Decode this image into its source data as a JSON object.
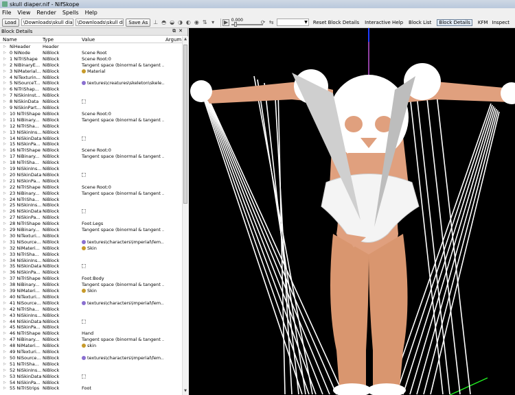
{
  "window": {
    "title": "skull diaper.nif - NifSkope"
  },
  "menu": [
    "File",
    "View",
    "Render",
    "Spells",
    "Help"
  ],
  "toolbar": {
    "load_label": "Load",
    "load_path": "\\Downloads\\skull diaper.nif",
    "save_path": "\\Downloads\\skull diaper.nif",
    "save_as_label": "Save As",
    "slider_value": "0.000",
    "links": [
      "Reset Block Details",
      "Interactive Help",
      "Block List",
      "Block Details",
      "KFM",
      "Inspect"
    ],
    "active_link": "Block Details"
  },
  "panel": {
    "title": "Block Details",
    "columns": [
      "Name",
      "Type",
      "Value",
      "Argum"
    ],
    "rows": [
      {
        "name": "NiHeader",
        "type": "Header",
        "value": "",
        "icon": ""
      },
      {
        "name": "0 NiNode",
        "type": "NiBlock",
        "value": "Scene Root",
        "icon": ""
      },
      {
        "name": "1 NiTriShape",
        "type": "NiBlock",
        "value": "Scene Root:0",
        "icon": ""
      },
      {
        "name": "2 NiBinaryE...",
        "type": "NiBlock",
        "value": "Tangent space (binormal & tangent ...",
        "icon": ""
      },
      {
        "name": "3 NiMaterial...",
        "type": "NiBlock",
        "value": "Material",
        "icon": "material"
      },
      {
        "name": "4 NiTexturin...",
        "type": "NiBlock",
        "value": "",
        "icon": ""
      },
      {
        "name": "5 NiSourceT...",
        "type": "NiBlock",
        "value": "textures\\creatures\\skeleton\\skele...",
        "icon": "texture"
      },
      {
        "name": "6 NiTriShap...",
        "type": "NiBlock",
        "value": "",
        "icon": ""
      },
      {
        "name": "7 NiSkinInst...",
        "type": "NiBlock",
        "value": "",
        "icon": ""
      },
      {
        "name": "8 NiSkinData",
        "type": "NiBlock",
        "value": "",
        "icon": "skin"
      },
      {
        "name": "9 NiSkinPart...",
        "type": "NiBlock",
        "value": "",
        "icon": ""
      },
      {
        "name": "10 NiTriShape",
        "type": "NiBlock",
        "value": "Scene Root:0",
        "icon": ""
      },
      {
        "name": "11 NiBinary...",
        "type": "NiBlock",
        "value": "Tangent space (binormal & tangent ...",
        "icon": ""
      },
      {
        "name": "12 NiTriSha...",
        "type": "NiBlock",
        "value": "",
        "icon": ""
      },
      {
        "name": "13 NiSkinIns...",
        "type": "NiBlock",
        "value": "",
        "icon": ""
      },
      {
        "name": "14 NiSkinData",
        "type": "NiBlock",
        "value": "",
        "icon": "skin"
      },
      {
        "name": "15 NiSkinPa...",
        "type": "NiBlock",
        "value": "",
        "icon": ""
      },
      {
        "name": "16 NiTriShape",
        "type": "NiBlock",
        "value": "Scene Root:0",
        "icon": ""
      },
      {
        "name": "17 NiBinary...",
        "type": "NiBlock",
        "value": "Tangent space (binormal & tangent ...",
        "icon": ""
      },
      {
        "name": "18 NiTriSha...",
        "type": "NiBlock",
        "value": "",
        "icon": ""
      },
      {
        "name": "19 NiSkinIns...",
        "type": "NiBlock",
        "value": "",
        "icon": ""
      },
      {
        "name": "20 NiSkinData",
        "type": "NiBlock",
        "value": "",
        "icon": "skin"
      },
      {
        "name": "21 NiSkinPa...",
        "type": "NiBlock",
        "value": "",
        "icon": ""
      },
      {
        "name": "22 NiTriShape",
        "type": "NiBlock",
        "value": "Scene Root:0",
        "icon": ""
      },
      {
        "name": "23 NiBinary...",
        "type": "NiBlock",
        "value": "Tangent space (binormal & tangent ...",
        "icon": ""
      },
      {
        "name": "24 NiTriSha...",
        "type": "NiBlock",
        "value": "",
        "icon": ""
      },
      {
        "name": "25 NiSkinIns...",
        "type": "NiBlock",
        "value": "",
        "icon": ""
      },
      {
        "name": "26 NiSkinData",
        "type": "NiBlock",
        "value": "",
        "icon": "skin"
      },
      {
        "name": "27 NiSkinPa...",
        "type": "NiBlock",
        "value": "",
        "icon": ""
      },
      {
        "name": "28 NiTriShape",
        "type": "NiBlock",
        "value": "Foot:Legs",
        "icon": ""
      },
      {
        "name": "29 NiBinary...",
        "type": "NiBlock",
        "value": "Tangent space (binormal & tangent ...",
        "icon": ""
      },
      {
        "name": "30 NiTexturi...",
        "type": "NiBlock",
        "value": "",
        "icon": ""
      },
      {
        "name": "31 NiSource...",
        "type": "NiBlock",
        "value": "textures\\characters\\imperial\\fem...",
        "icon": "texture"
      },
      {
        "name": "32 NiMateri...",
        "type": "NiBlock",
        "value": "Skin",
        "icon": "material"
      },
      {
        "name": "33 NiTriSha...",
        "type": "NiBlock",
        "value": "",
        "icon": ""
      },
      {
        "name": "34 NiSkinIns...",
        "type": "NiBlock",
        "value": "",
        "icon": ""
      },
      {
        "name": "35 NiSkinData",
        "type": "NiBlock",
        "value": "",
        "icon": "skin"
      },
      {
        "name": "36 NiSkinPa...",
        "type": "NiBlock",
        "value": "",
        "icon": ""
      },
      {
        "name": "37 NiTriShape",
        "type": "NiBlock",
        "value": "Foot:Body",
        "icon": ""
      },
      {
        "name": "38 NiBinary...",
        "type": "NiBlock",
        "value": "Tangent space (binormal & tangent ...",
        "icon": ""
      },
      {
        "name": "39 NiMateri...",
        "type": "NiBlock",
        "value": "Skin",
        "icon": "material"
      },
      {
        "name": "40 NiTexturi...",
        "type": "NiBlock",
        "value": "",
        "icon": ""
      },
      {
        "name": "41 NiSource...",
        "type": "NiBlock",
        "value": "textures\\characters\\imperial\\fem...",
        "icon": "texture"
      },
      {
        "name": "42 NiTriSha...",
        "type": "NiBlock",
        "value": "",
        "icon": ""
      },
      {
        "name": "43 NiSkinIns...",
        "type": "NiBlock",
        "value": "",
        "icon": ""
      },
      {
        "name": "44 NiSkinData",
        "type": "NiBlock",
        "value": "",
        "icon": "skin"
      },
      {
        "name": "45 NiSkinPa...",
        "type": "NiBlock",
        "value": "",
        "icon": ""
      },
      {
        "name": "46 NiTriShape",
        "type": "NiBlock",
        "value": "Hand",
        "icon": ""
      },
      {
        "name": "47 NiBinary...",
        "type": "NiBlock",
        "value": "Tangent space (binormal & tangent ...",
        "icon": ""
      },
      {
        "name": "48 NiMateri...",
        "type": "NiBlock",
        "value": "skin",
        "icon": "material"
      },
      {
        "name": "49 NiTexturi...",
        "type": "NiBlock",
        "value": "",
        "icon": ""
      },
      {
        "name": "50 NiSource...",
        "type": "NiBlock",
        "value": "textures\\characters\\imperial\\fem...",
        "icon": "texture"
      },
      {
        "name": "51 NiTriSha...",
        "type": "NiBlock",
        "value": "",
        "icon": ""
      },
      {
        "name": "52 NiSkinIns...",
        "type": "NiBlock",
        "value": "",
        "icon": ""
      },
      {
        "name": "53 NiSkinData",
        "type": "NiBlock",
        "value": "",
        "icon": "skin"
      },
      {
        "name": "54 NiSkinPa...",
        "type": "NiBlock",
        "value": "",
        "icon": ""
      },
      {
        "name": "55 NiTriStrips",
        "type": "NiBlock",
        "value": "Foot",
        "icon": ""
      }
    ]
  },
  "colors": {
    "viewport_bg": "#000000",
    "skin": "#e0a07e",
    "bone": "#ffffff",
    "axis_y": "#1f3cff",
    "axis_x": "#22ee22",
    "material_icon": "#c79a2a",
    "texture_icon": "#8a6fd0"
  }
}
